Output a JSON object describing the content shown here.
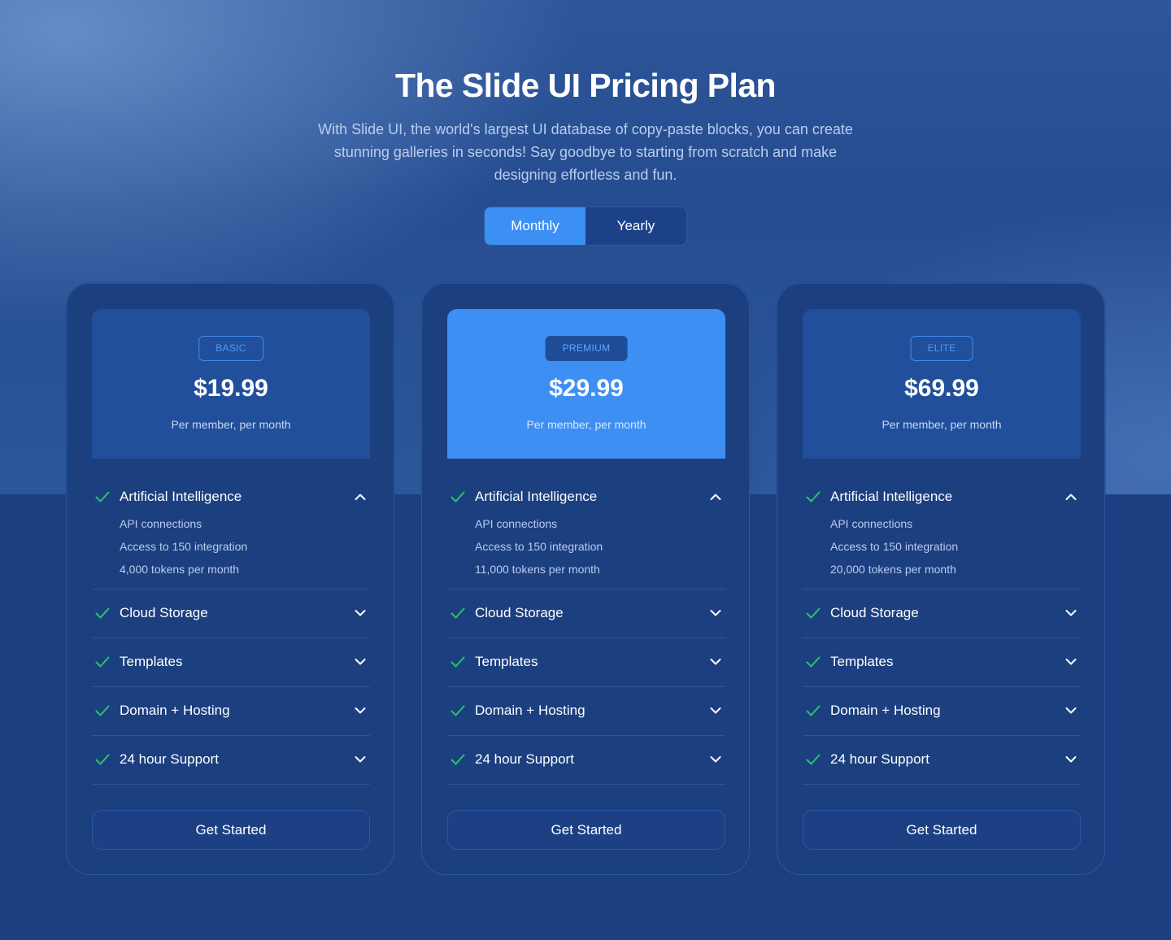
{
  "hero": {
    "title": "The Slide UI Pricing Plan",
    "subtitle": "With Slide UI, the world's largest UI database of copy-paste blocks, you can create stunning galleries in seconds! Say goodbye to starting from scratch and make designing effortless and fun."
  },
  "billing_toggle": {
    "options": [
      "Monthly",
      "Yearly"
    ],
    "selected": "Monthly"
  },
  "colors": {
    "accent": "#3d90f3",
    "check": "#27c46b",
    "background": "#1b3f80"
  },
  "plans": [
    {
      "badge": "BASIC",
      "price": "$19.99",
      "price_note": "Per member, per month",
      "features": [
        {
          "label": "Artificial Intelligence",
          "expanded": true,
          "details": [
            "API connections",
            "Access to 150 integration",
            "4,000 tokens per month"
          ]
        },
        {
          "label": "Cloud Storage",
          "expanded": false
        },
        {
          "label": "Templates",
          "expanded": false
        },
        {
          "label": "Domain + Hosting",
          "expanded": false
        },
        {
          "label": "24 hour Support",
          "expanded": false
        }
      ],
      "cta": "Get Started"
    },
    {
      "badge": "PREMIUM",
      "price": "$29.99",
      "price_note": "Per member, per month",
      "features": [
        {
          "label": "Artificial Intelligence",
          "expanded": true,
          "details": [
            "API connections",
            "Access to 150 integration",
            "11,000 tokens per month"
          ]
        },
        {
          "label": "Cloud Storage",
          "expanded": false
        },
        {
          "label": "Templates",
          "expanded": false
        },
        {
          "label": "Domain + Hosting",
          "expanded": false
        },
        {
          "label": "24 hour Support",
          "expanded": false
        }
      ],
      "cta": "Get Started"
    },
    {
      "badge": "ELITE",
      "price": "$69.99",
      "price_note": "Per member, per month",
      "features": [
        {
          "label": "Artificial Intelligence",
          "expanded": true,
          "details": [
            "API connections",
            "Access to 150 integration",
            "20,000 tokens per month"
          ]
        },
        {
          "label": "Cloud Storage",
          "expanded": false
        },
        {
          "label": "Templates",
          "expanded": false
        },
        {
          "label": "Domain + Hosting",
          "expanded": false
        },
        {
          "label": "24 hour Support",
          "expanded": false
        }
      ],
      "cta": "Get Started"
    }
  ]
}
